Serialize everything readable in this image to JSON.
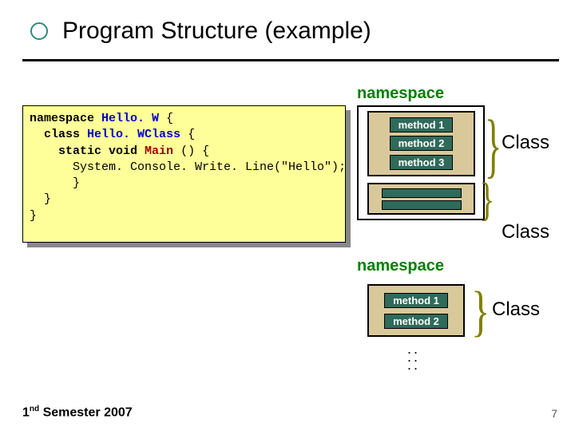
{
  "title": "Program Structure (example)",
  "code": {
    "line1_kw": "namespace",
    "line1_cls": "Hello. W",
    "line1_end": " {",
    "line2_pre": "  ",
    "line2_kw": "class",
    "line2_cls": " Hello. WClass",
    "line2_end": " {",
    "line3_pre": "    ",
    "line3_kw": "static void",
    "line3_mth": " Main",
    "line3_end": " () {",
    "line4": "      System. Console. Write. Line(\"Hello\");",
    "line5": "      }",
    "line6": "  }",
    "line7": "}"
  },
  "namespace_label": "namespace",
  "methods": {
    "m1": "method 1",
    "m2": "method 2",
    "m3": "method 3"
  },
  "class_label": "Class",
  "footer": {
    "text_a": "1",
    "text_sup": "nd",
    "text_b": " Semester 2007"
  },
  "page_number": "7"
}
